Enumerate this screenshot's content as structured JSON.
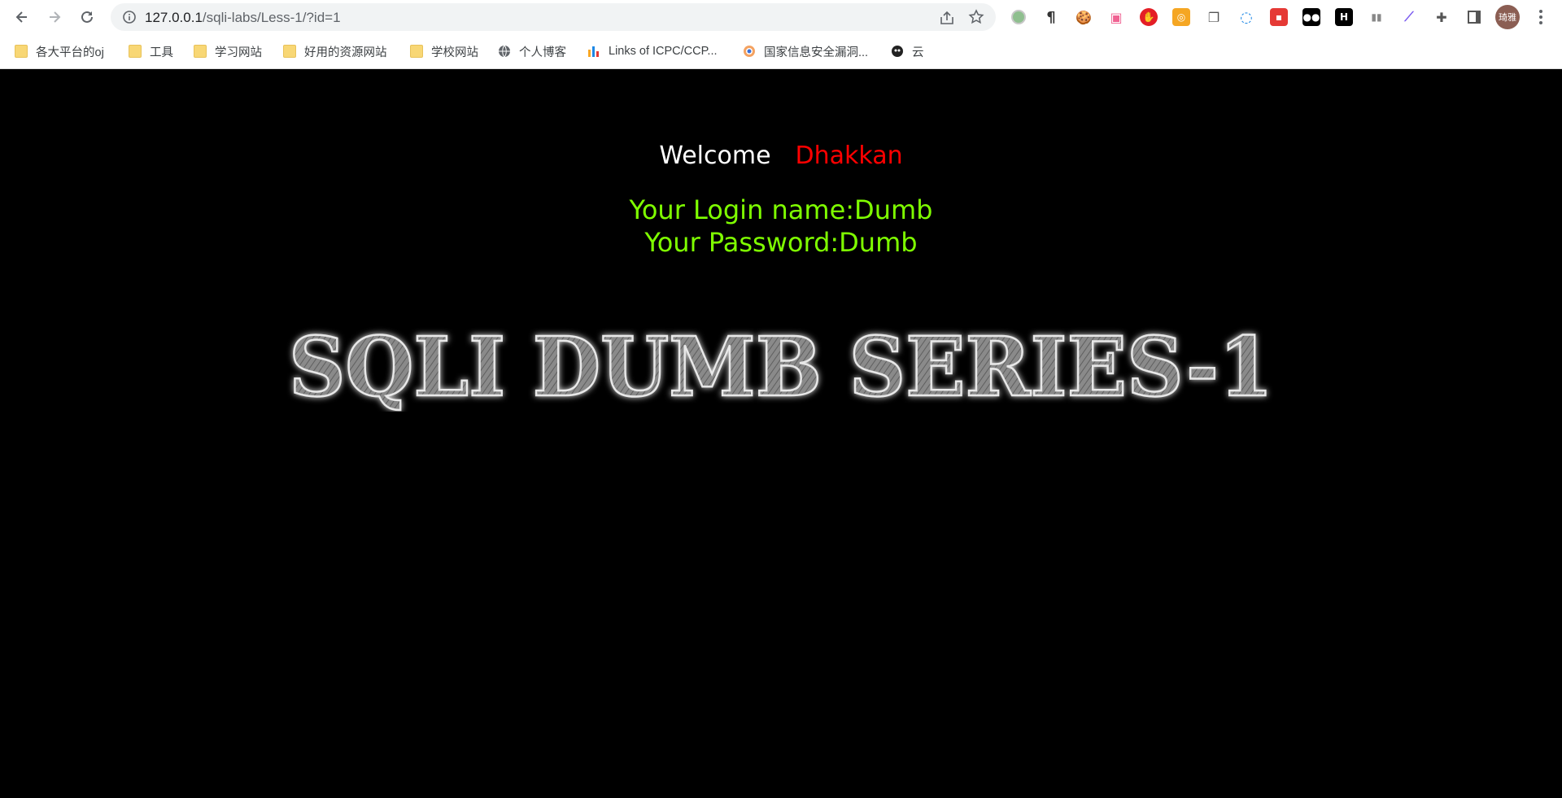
{
  "browser": {
    "url_host": "127.0.0.1",
    "url_path": "/sqli-labs/Less-1/?id=1",
    "profile_label": "琦雅"
  },
  "bookmarks": [
    {
      "label": "各大平台的oj",
      "icon": "folder-icon"
    },
    {
      "label": "工具",
      "icon": "folder-icon"
    },
    {
      "label": "学习网站",
      "icon": "folder-icon"
    },
    {
      "label": "好用的资源网站",
      "icon": "folder-icon"
    },
    {
      "label": "学校网站",
      "icon": "folder-icon"
    },
    {
      "label": "个人博客",
      "icon": "globe-icon"
    },
    {
      "label": "Links of ICPC/CCP...",
      "icon": "chart-icon"
    },
    {
      "label": "国家信息安全漏洞...",
      "icon": "site-icon"
    },
    {
      "label": "云",
      "icon": "avatar-icon"
    }
  ],
  "content": {
    "welcome": "Welcome",
    "user": "Dhakkan",
    "login_line": "Your Login name:Dumb",
    "password_line": "Your Password:Dumb",
    "banner": "SQLI DUMB SERIES-1"
  },
  "colors": {
    "background": "#000000",
    "welcome": "#ffffff",
    "user": "#ff0000",
    "credentials": "#7fff00"
  }
}
